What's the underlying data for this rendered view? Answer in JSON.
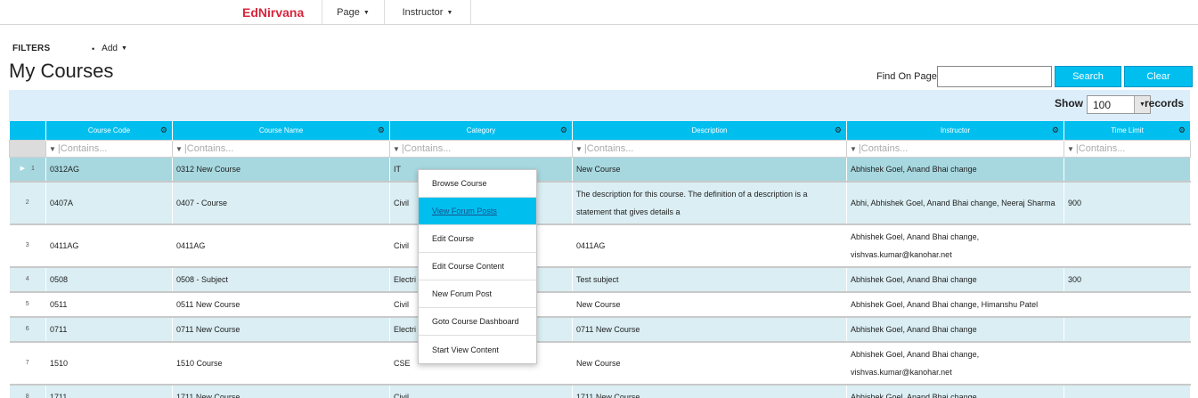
{
  "nav": {
    "brand": "EdNirvana",
    "page_label": "Page",
    "instructor_label": "Instructor"
  },
  "filters": {
    "label": "FILTERS",
    "add_label": "Add"
  },
  "page_title": "My Courses",
  "search": {
    "find_label": "Find On Page",
    "value": "",
    "search_label": "Search",
    "clear_label": "Clear"
  },
  "grid": {
    "show_label": "Show",
    "show_value": "100",
    "records_label": "records",
    "columns": [
      "Course Code",
      "Course Name",
      "Category",
      "Description",
      "Instructor",
      "Time Limit"
    ],
    "filter_placeholder": "Contains...",
    "rows": [
      {
        "idx": "1",
        "code": "0312AG",
        "name": "0312 New Course",
        "category": "IT",
        "description": "New Course",
        "instructor": "Abhishek Goel, Anand Bhai change",
        "time": ""
      },
      {
        "idx": "2",
        "code": "0407A",
        "name": "0407 - Course",
        "category": "Civil",
        "description": "The description for this course. The definition of a description is a statement that gives details a",
        "instructor": "Abhi, Abhishek Goel, Anand Bhai change, Neeraj Sharma",
        "time": "900"
      },
      {
        "idx": "3",
        "code": "0411AG",
        "name": "0411AG",
        "category": "Civil",
        "description": "0411AG",
        "instructor": "Abhishek Goel, Anand Bhai change, vishvas.kumar@kanohar.net",
        "time": ""
      },
      {
        "idx": "4",
        "code": "0508",
        "name": "0508 - Subject",
        "category": "Electri",
        "description": "Test subject",
        "instructor": "Abhishek Goel, Anand Bhai change",
        "time": "300"
      },
      {
        "idx": "5",
        "code": "0511",
        "name": "0511 New Course",
        "category": "Civil",
        "description": "New Course",
        "instructor": "Abhishek Goel, Anand Bhai change, Himanshu Patel",
        "time": ""
      },
      {
        "idx": "6",
        "code": "0711",
        "name": "0711 New Course",
        "category": "Electri",
        "description": "0711 New Course",
        "instructor": "Abhishek Goel, Anand Bhai change",
        "time": ""
      },
      {
        "idx": "7",
        "code": "1510",
        "name": "1510 Course",
        "category": "CSE",
        "description": "New Course",
        "instructor": "Abhishek Goel, Anand Bhai change, vishvas.kumar@kanohar.net",
        "time": ""
      },
      {
        "idx": "8",
        "code": "1711",
        "name": "1711 New Course",
        "category": "Civil",
        "description": "1711 New Course",
        "instructor": "Abhishek Goel, Anand Bhai change",
        "time": ""
      }
    ]
  },
  "context_menu": {
    "items": [
      "Browse Course",
      "View Forum Posts",
      "Edit Course",
      "Edit Course Content",
      "New Forum Post",
      "Goto Course Dashboard",
      "Start View Content"
    ]
  },
  "colors": {
    "brand": "#d7263d",
    "accent": "#00bfef",
    "row_alt": "#daeef3",
    "row_selected": "#a7d8e0"
  }
}
